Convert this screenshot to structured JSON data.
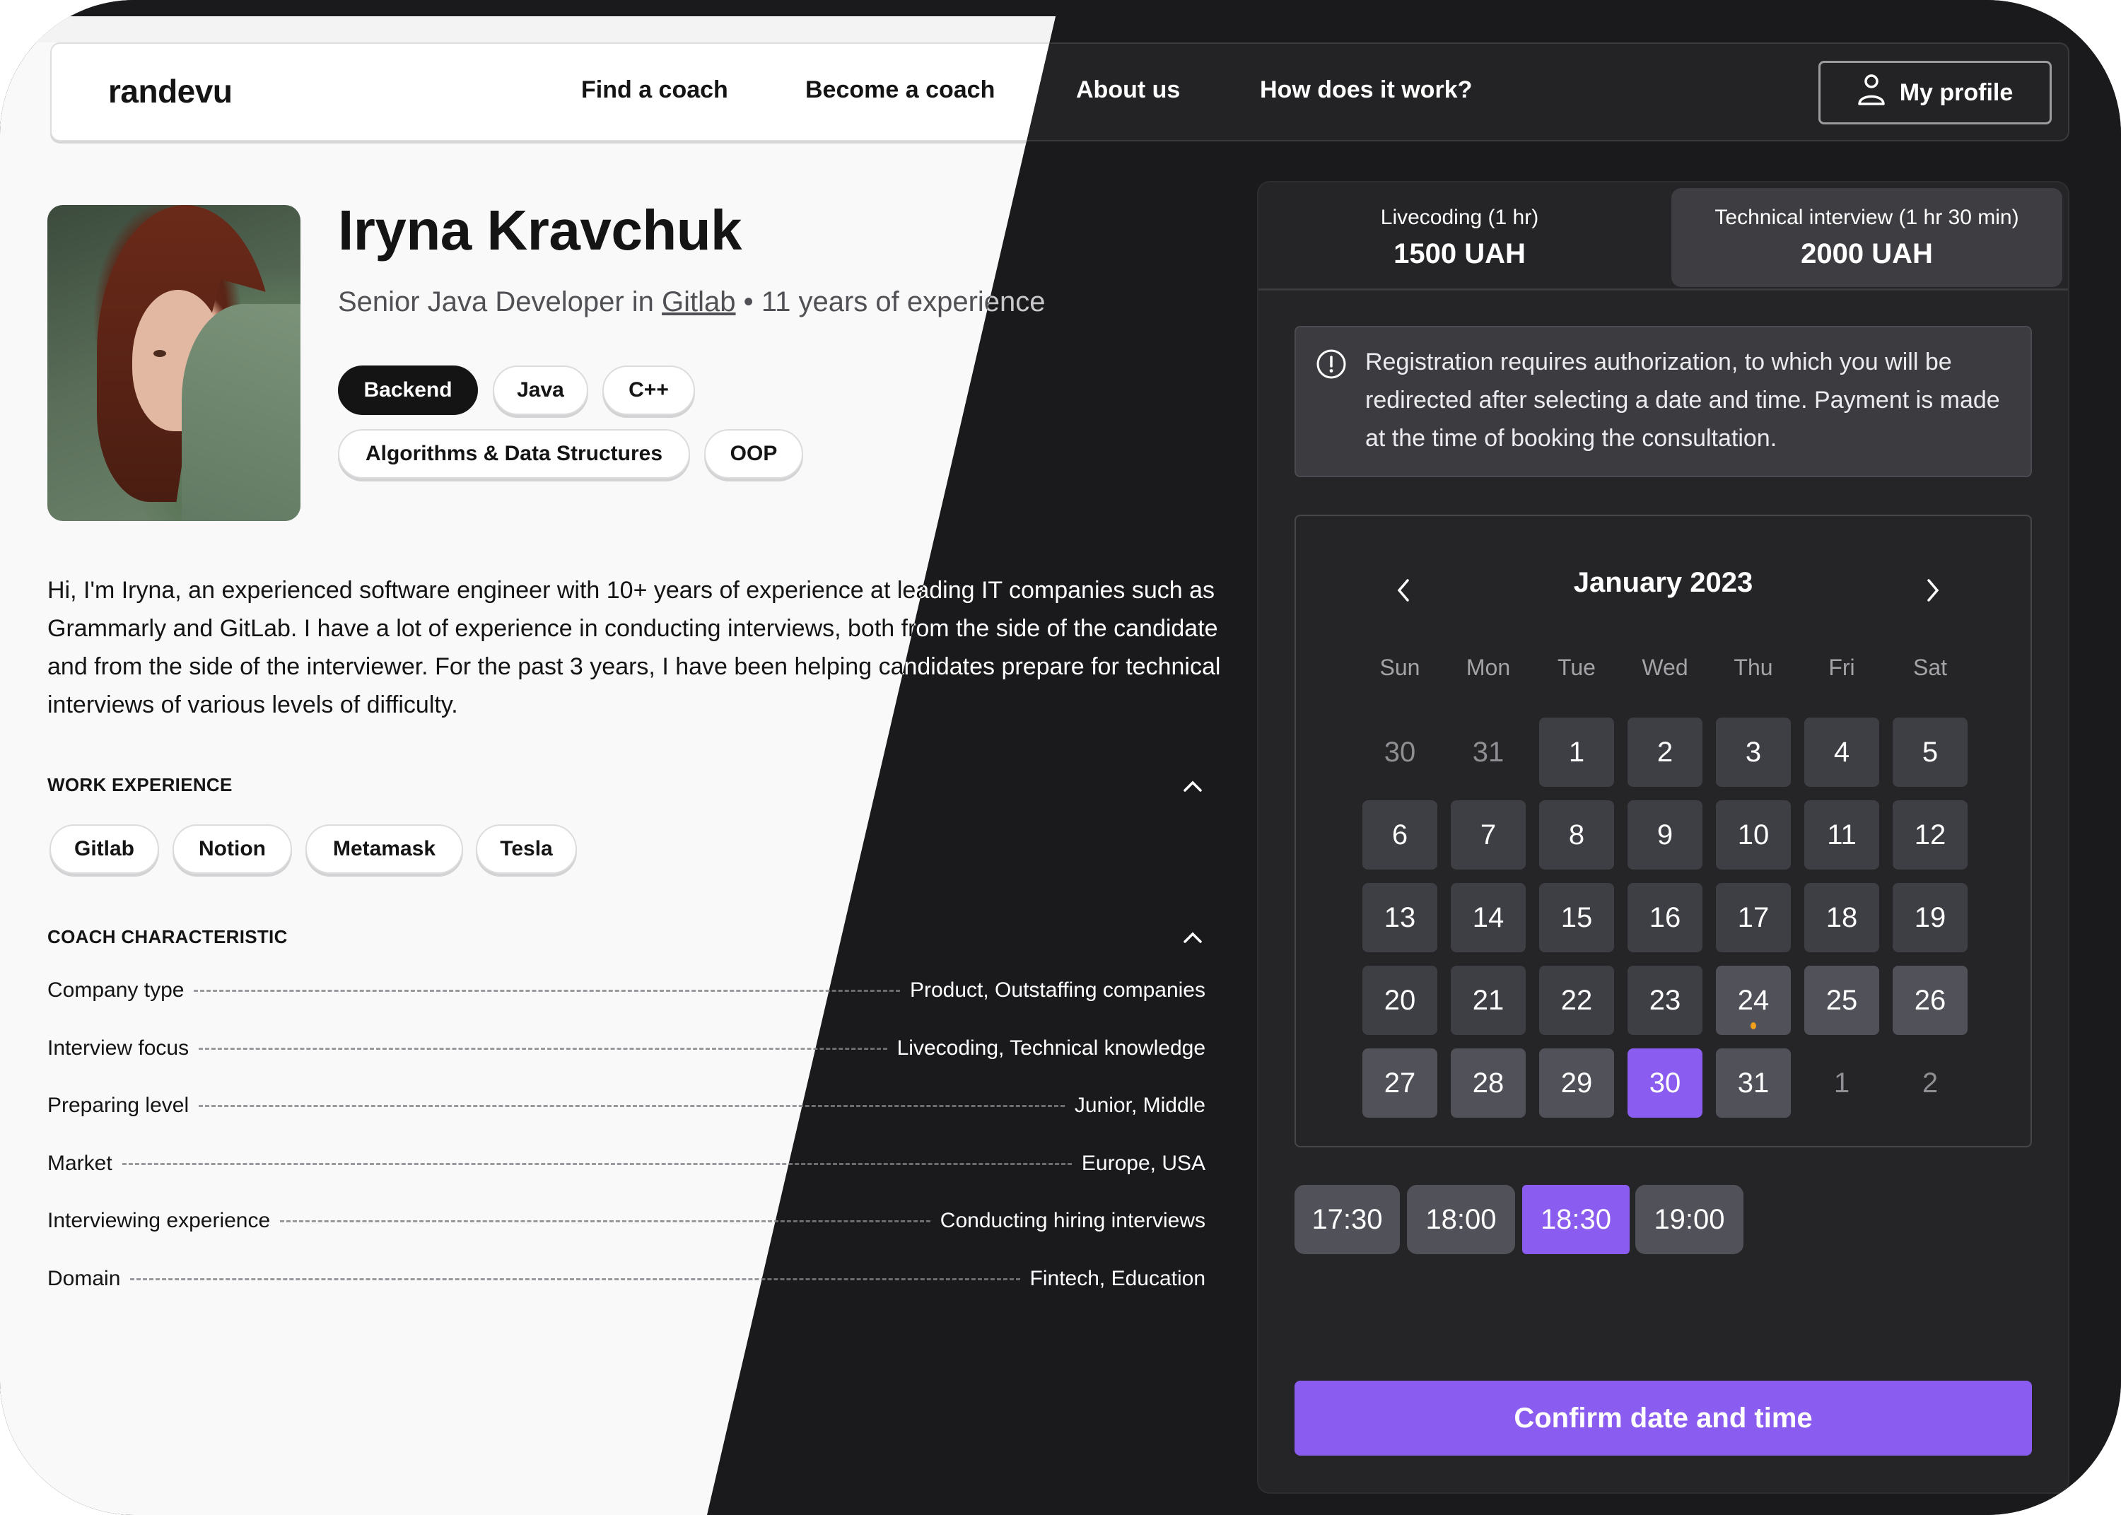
{
  "header": {
    "logo": "randevu",
    "nav": [
      {
        "label": "Find a coach"
      },
      {
        "label": "Become a coach"
      },
      {
        "label": "About us"
      },
      {
        "label": "How does it work?"
      }
    ],
    "profile_button": {
      "label": "My profile",
      "icon": "user-icon"
    }
  },
  "profile": {
    "name": "Iryna Kravchuk",
    "role": "Senior Java Developer in",
    "company": "Gitlab",
    "separator": "•",
    "experience": "11 years of experience",
    "photo": "coach-photo",
    "tags": [
      {
        "label": "Backend",
        "active": true
      },
      {
        "label": "Java",
        "active": false
      },
      {
        "label": "C++",
        "active": false
      },
      {
        "label": "Algorithms & Data Structures",
        "active": false
      },
      {
        "label": "OOP",
        "active": false
      }
    ],
    "bio": "Hi, I'm Iryna, an experienced software engineer with 10+ years of experience at leading IT companies such as Grammarly and GitLab. I have a lot of experience in conducting interviews, both from the side of the candidate and from the side of the interviewer. For the past 3 years, I have been helping candidates prepare for technical interviews of various levels of difficulty."
  },
  "work_experience": {
    "title": "WORK EXPERIENCE",
    "companies": [
      "Gitlab",
      "Notion",
      "Metamask",
      "Tesla"
    ]
  },
  "coach_characteristic": {
    "title": "COACH CHARACTERISTIC",
    "rows": [
      {
        "label": "Company type",
        "value": "Product, Outstaffing companies"
      },
      {
        "label": "Interview focus",
        "value": "Livecoding, Technical knowledge"
      },
      {
        "label": "Preparing level",
        "value": "Junior, Middle"
      },
      {
        "label": "Market",
        "value": "Europe, USA"
      },
      {
        "label": "Interviewing experience",
        "value": "Conducting hiring interviews"
      },
      {
        "label": "Domain",
        "value": "Fintech, Education"
      }
    ]
  },
  "booking": {
    "tabs": [
      {
        "label": "Livecoding (1 hr)",
        "price": "1500 UAH",
        "selected": false
      },
      {
        "label": "Technical interview (1 hr 30 min)",
        "price": "2000 UAH",
        "selected": true
      }
    ],
    "info": "Registration requires authorization, to which you will be redirected after selecting a date and time. Payment is made at the time of booking the consultation.",
    "calendar": {
      "month": "January 2023",
      "weekdays": [
        "Sun",
        "Mon",
        "Tue",
        "Wed",
        "Thu",
        "Fri",
        "Sat"
      ],
      "days": [
        {
          "n": "30",
          "state": "outside"
        },
        {
          "n": "31",
          "state": "outside"
        },
        {
          "n": "1",
          "state": "past"
        },
        {
          "n": "2",
          "state": "past"
        },
        {
          "n": "3",
          "state": "past"
        },
        {
          "n": "4",
          "state": "past"
        },
        {
          "n": "5",
          "state": "past"
        },
        {
          "n": "6",
          "state": "past"
        },
        {
          "n": "7",
          "state": "past"
        },
        {
          "n": "8",
          "state": "past"
        },
        {
          "n": "9",
          "state": "past"
        },
        {
          "n": "10",
          "state": "past"
        },
        {
          "n": "11",
          "state": "past"
        },
        {
          "n": "12",
          "state": "past"
        },
        {
          "n": "13",
          "state": "past"
        },
        {
          "n": "14",
          "state": "past"
        },
        {
          "n": "15",
          "state": "past"
        },
        {
          "n": "16",
          "state": "past"
        },
        {
          "n": "17",
          "state": "past"
        },
        {
          "n": "18",
          "state": "past"
        },
        {
          "n": "19",
          "state": "past"
        },
        {
          "n": "20",
          "state": "past"
        },
        {
          "n": "21",
          "state": "past"
        },
        {
          "n": "22",
          "state": "past"
        },
        {
          "n": "23",
          "state": "past"
        },
        {
          "n": "24",
          "state": "avail",
          "today": true
        },
        {
          "n": "25",
          "state": "avail"
        },
        {
          "n": "26",
          "state": "avail"
        },
        {
          "n": "27",
          "state": "avail"
        },
        {
          "n": "28",
          "state": "avail"
        },
        {
          "n": "29",
          "state": "avail"
        },
        {
          "n": "30",
          "state": "selected"
        },
        {
          "n": "31",
          "state": "avail"
        },
        {
          "n": "1",
          "state": "outside"
        },
        {
          "n": "2",
          "state": "outside"
        }
      ]
    },
    "time_slots": [
      {
        "label": "17:30",
        "selected": false
      },
      {
        "label": "18:00",
        "selected": false
      },
      {
        "label": "18:30",
        "selected": true
      },
      {
        "label": "19:00",
        "selected": false
      }
    ],
    "confirm_label": "Confirm date and time"
  },
  "colors": {
    "accent": "#8b5cf0",
    "today_dot": "#f2a01c",
    "dark_bg": "#1a1a1c",
    "light_bg": "#f9f9f9"
  }
}
